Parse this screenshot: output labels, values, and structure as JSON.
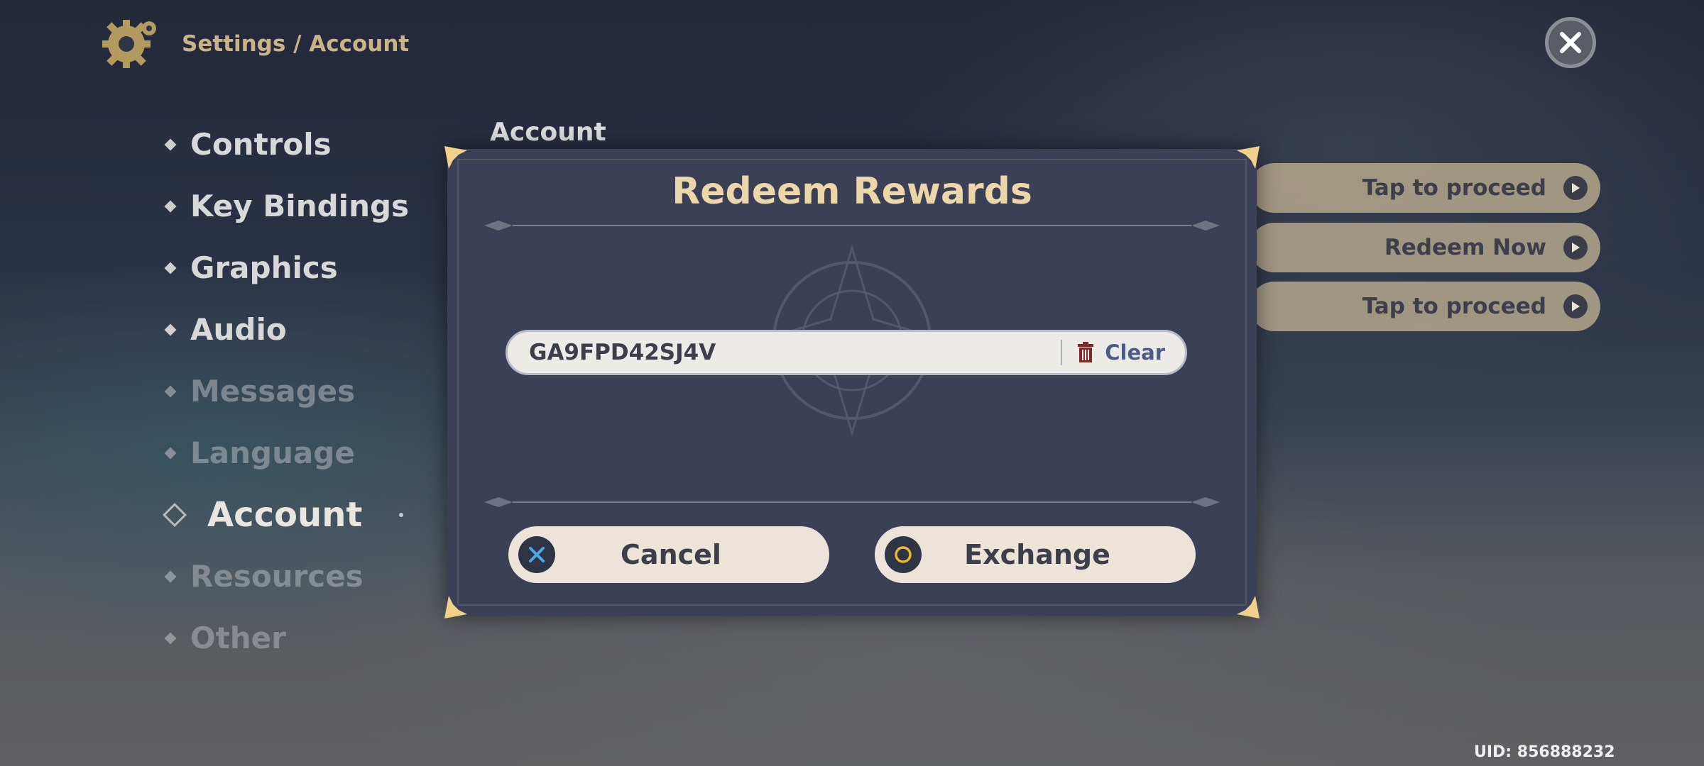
{
  "header": {
    "gear_icon": "gear-icon",
    "breadcrumb": "Settings / Account",
    "close_icon": "close-icon"
  },
  "menu": {
    "items": [
      {
        "label": "Controls",
        "state": "normal"
      },
      {
        "label": "Key Bindings",
        "state": "normal"
      },
      {
        "label": "Graphics",
        "state": "normal"
      },
      {
        "label": "Audio",
        "state": "normal"
      },
      {
        "label": "Messages",
        "state": "faded"
      },
      {
        "label": "Language",
        "state": "faded"
      },
      {
        "label": "Account",
        "state": "active"
      },
      {
        "label": "Resources",
        "state": "faded"
      },
      {
        "label": "Other",
        "state": "faded"
      }
    ]
  },
  "section_title": "Account",
  "actions": [
    {
      "label": "Tap to proceed"
    },
    {
      "label": "Redeem Now"
    },
    {
      "label": "Tap to proceed"
    }
  ],
  "modal": {
    "title": "Redeem Rewards",
    "code_value": "GA9FPD42SJ4V",
    "clear_label": "Clear",
    "cancel_label": "Cancel",
    "exchange_label": "Exchange",
    "cancel_icon": "x-button-icon",
    "exchange_icon": "circle-button-icon"
  },
  "uid": "UID: 856888232",
  "colors": {
    "accent_gold": "#ecd7a8",
    "modal_bg": "#3b4057",
    "button_bg": "#ece4d8",
    "clear_blue": "#4d5a86"
  }
}
